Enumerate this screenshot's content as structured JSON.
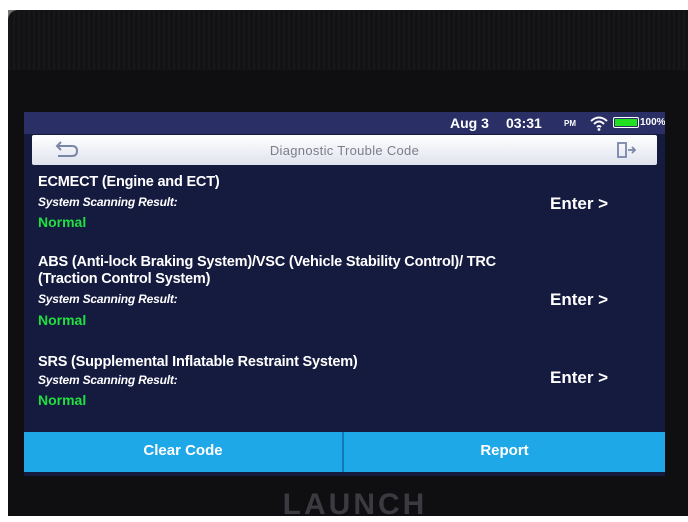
{
  "statusbar": {
    "date": "Aug 3",
    "time": "03:31",
    "ampm": "PM",
    "battery": "100%",
    "wifi_icon": "wifi-icon",
    "battery_icon": "battery-icon"
  },
  "header": {
    "title": "Diagnostic Trouble Code",
    "back_icon": "back-arrow-icon",
    "exit_icon": "exit-icon"
  },
  "systems": [
    {
      "name": "ECMECT (Engine and ECT)",
      "scan_label": "System Scanning Result:",
      "result": "Normal",
      "action": "Enter >"
    },
    {
      "name": "ABS (Anti-lock Braking System)/VSC (Vehicle Stability Control)/ TRC (Traction Control System)",
      "scan_label": "System Scanning Result:",
      "result": "Normal",
      "action": "Enter >"
    },
    {
      "name": "SRS (Supplemental Inflatable Restraint System)",
      "scan_label": "System Scanning Result:",
      "result": "Normal",
      "action": "Enter >"
    }
  ],
  "footer": {
    "clear_label": "Clear Code",
    "report_label": "Report"
  },
  "device": {
    "brand": "LAUNCH"
  },
  "colors": {
    "screen_bg": "#151a3f",
    "statusbar_bg": "#2a2f66",
    "result_normal": "#20e040",
    "button_bar": "#1fa8e8"
  }
}
